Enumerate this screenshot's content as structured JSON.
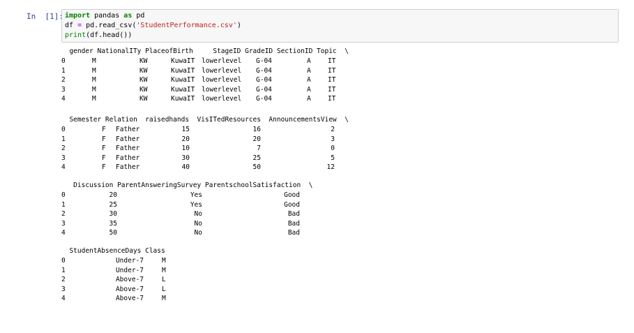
{
  "prompt": "In  [1]:",
  "code": {
    "line1": {
      "kw1": "import",
      "mod": " pandas ",
      "kw2": "as",
      "alias": " pd"
    },
    "line2": {
      "pre": "df ",
      "eq": "=",
      "mid": " pd.read_csv(",
      "str": "'StudentPerformance.csv'",
      "post": ")"
    },
    "line3": {
      "fn": "print",
      "rest": "(df.head())"
    }
  },
  "blocks": [
    {
      "header": "  gender NationalITy PlaceofBirth     StageID GradeID SectionID Topic  \\",
      "rows": [
        [
          "0",
          "M",
          "KW",
          "KuwaIT",
          "lowerlevel",
          "G-04",
          "A",
          "IT"
        ],
        [
          "1",
          "M",
          "KW",
          "KuwaIT",
          "lowerlevel",
          "G-04",
          "A",
          "IT"
        ],
        [
          "2",
          "M",
          "KW",
          "KuwaIT",
          "lowerlevel",
          "G-04",
          "A",
          "IT"
        ],
        [
          "3",
          "M",
          "KW",
          "KuwaIT",
          "lowerlevel",
          "G-04",
          "A",
          "IT"
        ],
        [
          "4",
          "M",
          "KW",
          "KuwaIT",
          "lowerlevel",
          "G-04",
          "A",
          "IT"
        ]
      ]
    },
    {
      "header": "  Semester Relation  raisedhands  VisITedResources  AnnouncementsView  \\",
      "rows": [
        [
          "0",
          "F",
          "Father",
          "15",
          "16",
          "2"
        ],
        [
          "1",
          "F",
          "Father",
          "20",
          "20",
          "3"
        ],
        [
          "2",
          "F",
          "Father",
          "10",
          "7",
          "0"
        ],
        [
          "3",
          "F",
          "Father",
          "30",
          "25",
          "5"
        ],
        [
          "4",
          "F",
          "Father",
          "40",
          "50",
          "12"
        ]
      ]
    },
    {
      "header": "   Discussion ParentAnsweringSurvey ParentschoolSatisfaction  \\",
      "rows": [
        [
          "0",
          "20",
          "Yes",
          "Good"
        ],
        [
          "1",
          "25",
          "Yes",
          "Good"
        ],
        [
          "2",
          "30",
          "No",
          "Bad"
        ],
        [
          "3",
          "35",
          "No",
          "Bad"
        ],
        [
          "4",
          "50",
          "No",
          "Bad"
        ]
      ]
    },
    {
      "header": "  StudentAbsenceDays Class",
      "rows": [
        [
          "0",
          "Under-7",
          "M"
        ],
        [
          "1",
          "Under-7",
          "M"
        ],
        [
          "2",
          "Above-7",
          "L"
        ],
        [
          "3",
          "Above-7",
          "L"
        ],
        [
          "4",
          "Above-7",
          "M"
        ]
      ]
    }
  ]
}
